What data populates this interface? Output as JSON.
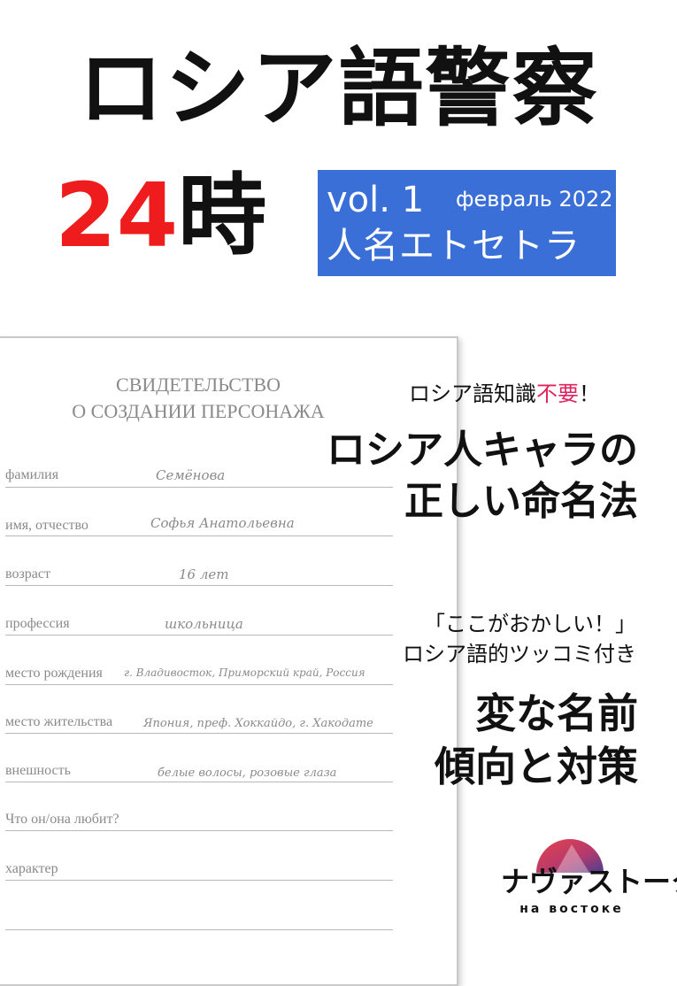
{
  "cover": {
    "title": "ロシア語警察",
    "hours_number": "24",
    "hours_suffix": "時",
    "volume": "vol. 1",
    "date": "февраль 2022",
    "theme": "人名エトセトラ"
  },
  "certificate": {
    "heading_line1": "СВИДЕТЕЛЬСТВО",
    "heading_line2": "О СОЗДАНИИ ПЕРСОНАЖА",
    "fields": [
      {
        "label": "фамилия",
        "value": "Семёнова"
      },
      {
        "label": "имя, отчество",
        "value": "Софья Анатольевна"
      },
      {
        "label": "возраст",
        "value": "16 лет"
      },
      {
        "label": "профессия",
        "value": "школьница"
      },
      {
        "label": "место рождения",
        "value": "г. Владивосток, Приморский край, Россия"
      },
      {
        "label": "место жительства",
        "value": "Япония, преф. Хоккайдо, г. Хакодате"
      },
      {
        "label": "внешность",
        "value": "белые волосы, розовые глаза"
      },
      {
        "label": "Что он/она любит?",
        "value": ""
      },
      {
        "label": "характер",
        "value": ""
      }
    ]
  },
  "features": {
    "intro_prefix": "ロシア語知識",
    "intro_highlight": "不要",
    "intro_suffix": "！",
    "headline1_line1": "ロシア人キャラの",
    "headline1_line2": "正しい命名法",
    "quote_line1": "「ここがおかしい！」",
    "quote_line2": "ロシア語的ツッコミ付き",
    "headline2_line1": "変な名前",
    "headline2_line2": "傾向と対策"
  },
  "logo": {
    "name_jp": "ナヴァストーク",
    "name_ru": "на востоке"
  },
  "colors": {
    "accent_red": "#ee1c1c",
    "accent_pink": "#e0245e",
    "box_blue": "#3b6fd8",
    "logo_red": "#e8414a",
    "logo_purple": "#4a3f8f"
  }
}
